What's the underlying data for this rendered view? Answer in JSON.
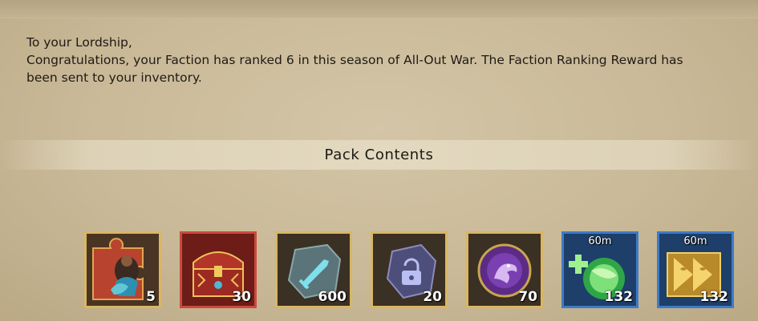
{
  "mail": {
    "greeting": "To your Lordship,",
    "body_line1": "Congratulations, your Faction has ranked 6 in this season of All-Out War. The Faction Ranking Reward has",
    "body_line2": "been sent to your inventory."
  },
  "pack": {
    "title": "Pack Contents",
    "items": [
      {
        "icon": "hero-puzzle-piece-icon",
        "count": "5",
        "frame": "gold"
      },
      {
        "icon": "treasure-chest-icon",
        "count": "30",
        "frame": "red"
      },
      {
        "icon": "sword-rune-stone-icon",
        "count": "600",
        "frame": "gold"
      },
      {
        "icon": "lock-rune-stone-icon",
        "count": "20",
        "frame": "gold"
      },
      {
        "icon": "dragon-orb-icon",
        "count": "70",
        "frame": "gold"
      },
      {
        "icon": "healing-potion-icon",
        "count": "132",
        "duration": "60m",
        "frame": "blue"
      },
      {
        "icon": "speedup-arrows-icon",
        "count": "132",
        "duration": "60m",
        "frame": "blue"
      }
    ]
  }
}
